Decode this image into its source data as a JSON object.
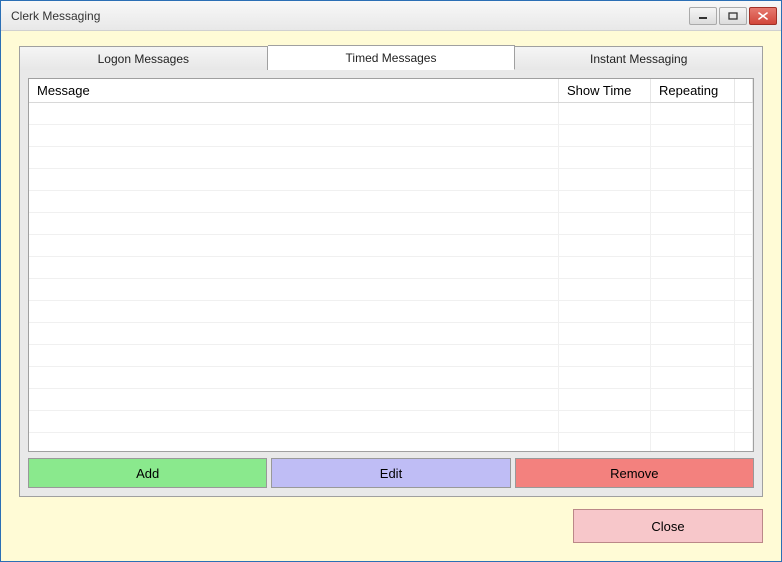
{
  "window": {
    "title": "Clerk Messaging"
  },
  "tabs": {
    "logon": "Logon Messages",
    "timed": "Timed Messages",
    "instant": "Instant Messaging",
    "active": "timed"
  },
  "grid": {
    "columns": {
      "message": "Message",
      "showtime": "Show Time",
      "repeating": "Repeating"
    },
    "rows": []
  },
  "buttons": {
    "add": "Add",
    "edit": "Edit",
    "remove": "Remove",
    "close": "Close"
  },
  "colors": {
    "add": "#8ae98d",
    "edit": "#bfbdf5",
    "remove": "#f3817e",
    "close": "#f7c7ca",
    "client_bg": "#fffbd6"
  }
}
